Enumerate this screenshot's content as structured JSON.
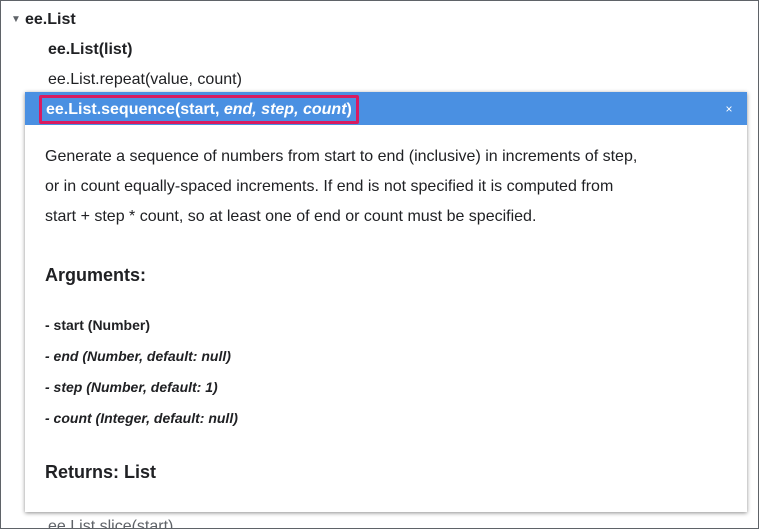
{
  "tree": {
    "parent_label": "ee.List",
    "item1_label": "ee.List(list)",
    "item2_label": "ee.List.repeat(value, count)",
    "item_hidden_label": "ee.List.slice(start)"
  },
  "popup": {
    "signature": {
      "prefix": "ee.List.sequence(start, ",
      "opt_params": "end, step, count",
      "suffix": ")"
    },
    "close_glyph": "×",
    "description_lines": [
      "Generate a sequence of numbers from start to end (inclusive) in increments of step,",
      "or in count equally-spaced increments. If end is not specified it is computed from",
      "start + step * count, so at least one of end or count must be specified."
    ],
    "arguments_title": "Arguments:",
    "arguments": [
      "- start (Number)",
      "- end (Number, default: null)",
      "- step (Number, default: 1)",
      "- count (Integer, default: null)"
    ],
    "returns_title": "Returns: List"
  },
  "colors": {
    "header_bg": "#4a90e2",
    "highlight_border": "#d81b60"
  }
}
